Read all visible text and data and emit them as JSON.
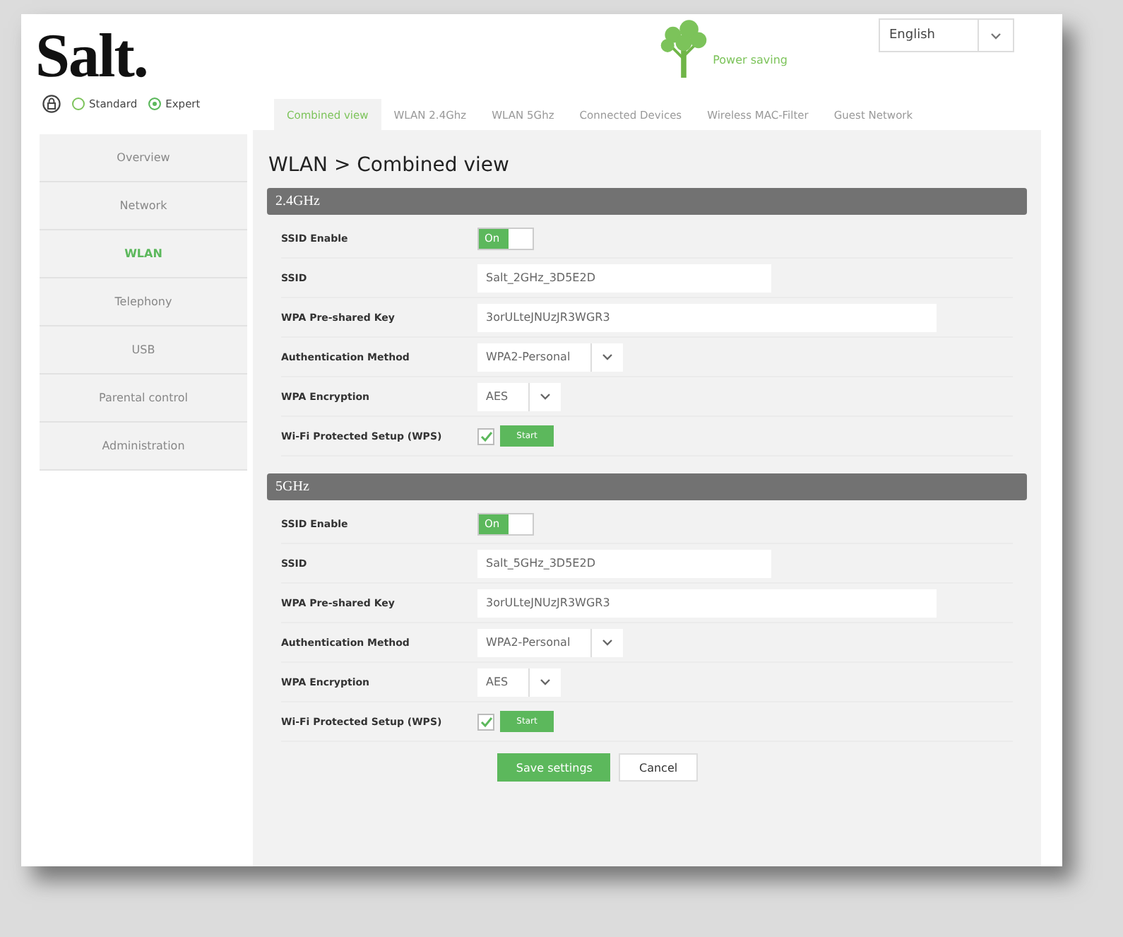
{
  "logo": "Salt.",
  "mode_options": [
    {
      "label": "Standard",
      "selected": false
    },
    {
      "label": "Expert",
      "selected": true
    }
  ],
  "power_saving": "Power saving",
  "language": "English",
  "tabs": [
    {
      "label": "Combined view",
      "selected": true
    },
    {
      "label": "WLAN 2.4Ghz",
      "selected": false
    },
    {
      "label": "WLAN 5Ghz",
      "selected": false
    },
    {
      "label": "Connected Devices",
      "selected": false
    },
    {
      "label": "Wireless MAC-Filter",
      "selected": false
    },
    {
      "label": "Guest Network",
      "selected": false
    }
  ],
  "sidebar": {
    "items": [
      {
        "label": "Overview",
        "selected": false
      },
      {
        "label": "Network",
        "selected": false
      },
      {
        "label": "WLAN",
        "selected": true
      },
      {
        "label": "Telephony",
        "selected": false
      },
      {
        "label": "USB",
        "selected": false
      },
      {
        "label": "Parental control",
        "selected": false
      },
      {
        "label": "Administration",
        "selected": false
      }
    ]
  },
  "page_title": "WLAN > Combined view",
  "sections": [
    {
      "title": "2.4GHz",
      "fields": [
        {
          "kind": "toggle",
          "label": "SSID Enable",
          "on": true,
          "text": "On"
        },
        {
          "kind": "ssid",
          "label": "SSID",
          "value": "Salt_2GHz_3D5E2D"
        },
        {
          "kind": "key",
          "label": "WPA Pre-shared Key",
          "value": "3orULteJNUzJR3WGR3"
        },
        {
          "kind": "select",
          "label": "Authentication Method",
          "value": "WPA2-Personal"
        },
        {
          "kind": "select",
          "label": "WPA Encryption",
          "value": "AES"
        },
        {
          "kind": "wps",
          "label": "Wi-Fi Protected Setup (WPS)",
          "checked": true,
          "button": "Start"
        }
      ]
    },
    {
      "title": "5GHz",
      "fields": [
        {
          "kind": "toggle",
          "label": "SSID Enable",
          "on": true,
          "text": "On"
        },
        {
          "kind": "ssid",
          "label": "SSID",
          "value": "Salt_5GHz_3D5E2D"
        },
        {
          "kind": "key",
          "label": "WPA Pre-shared Key",
          "value": "3orULteJNUzJR3WGR3"
        },
        {
          "kind": "select",
          "label": "Authentication Method",
          "value": "WPA2-Personal"
        },
        {
          "kind": "select",
          "label": "WPA Encryption",
          "value": "AES"
        },
        {
          "kind": "wps",
          "label": "Wi-Fi Protected Setup (WPS)",
          "checked": true,
          "button": "Start"
        }
      ]
    }
  ],
  "buttons": [
    {
      "label": "Save settings",
      "kind": "primary"
    },
    {
      "label": "Cancel",
      "kind": "secondary"
    }
  ]
}
